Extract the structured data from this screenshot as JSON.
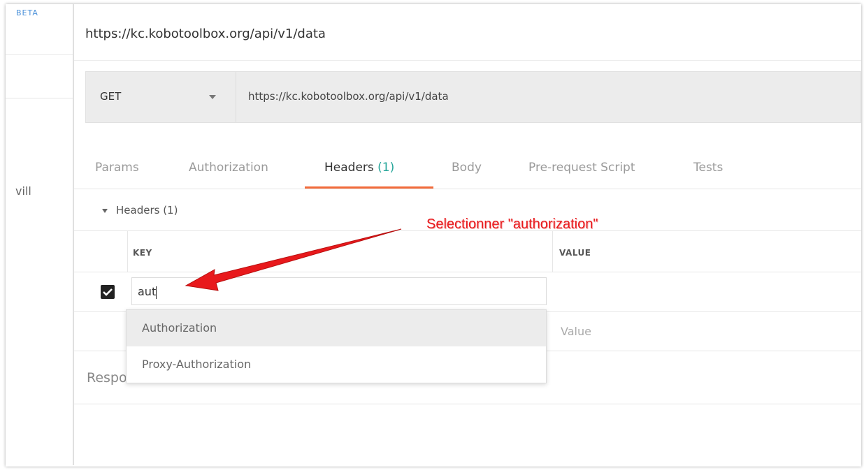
{
  "sidebar": {
    "top_label": "BETA",
    "fragment": "vill"
  },
  "request": {
    "title": "https://kc.kobotoolbox.org/api/v1/data",
    "method": "GET",
    "url": "https://kc.kobotoolbox.org/api/v1/data"
  },
  "tabs": [
    {
      "label": "Params"
    },
    {
      "label": "Authorization"
    },
    {
      "label": "Headers ",
      "count": "(1)"
    },
    {
      "label": "Body"
    },
    {
      "label": "Pre-request Script"
    },
    {
      "label": "Tests"
    }
  ],
  "headers_section": {
    "label": "Headers (1)"
  },
  "table": {
    "key_header": "KEY",
    "value_header": "VALUE",
    "row1_key": "aut",
    "row2_value_placeholder": "Value"
  },
  "autocomplete": [
    "Authorization",
    "Proxy-Authorization"
  ],
  "response": {
    "label": "Response"
  },
  "annotation": {
    "text": "Selectionner \"authorization\"",
    "color": "#e8191c"
  },
  "colors": {
    "accent": "#f26b3a",
    "count": "#26a69a"
  }
}
